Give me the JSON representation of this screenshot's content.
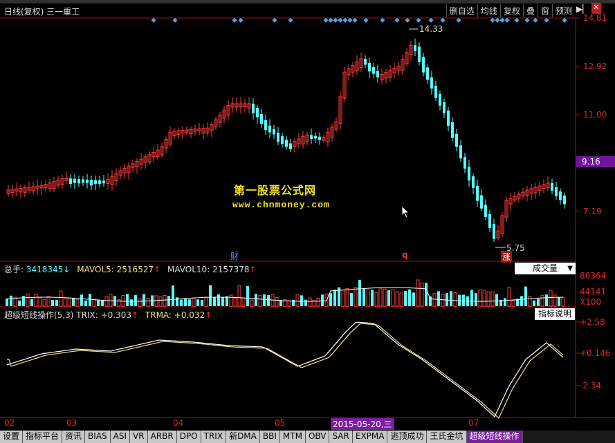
{
  "window": {
    "title": "日线(复权) 三一重工"
  },
  "toolbar": {
    "items": [
      "删自选",
      "均线",
      "复权",
      "叠",
      "窗",
      "预测"
    ],
    "arrow_icon": "arrow-right-icon",
    "close_icon": "close-icon"
  },
  "price_axis": [
    "14.81",
    "12.92",
    "11.00",
    "9.16",
    "7.19"
  ],
  "current_price": "9.16",
  "annotations": {
    "high": "14.33",
    "low": "5.75",
    "marker_cai": "财",
    "marker_q": "q",
    "marker_zhang": "涨"
  },
  "watermark": {
    "line1": "第一股票公式网",
    "line2": "www.chnmoney.com"
  },
  "volume": {
    "total_label": "总手:",
    "total_value": "3418345",
    "mavol5_label": "MAVOL5:",
    "mavol5_value": "2516527",
    "mavol10_label": "MAVOL10:",
    "mavol10_value": "2157378",
    "type_select": "成交量",
    "axis": [
      "86364",
      "44141",
      "X100"
    ]
  },
  "indicator": {
    "name": "超级短线操作(5,3)",
    "trix_label": "TRIX:",
    "trix_value": "+0.303",
    "trma_label": "TRMA:",
    "trma_value": "+0.032",
    "help_button": "指标说明",
    "axis": [
      "+2.58",
      "+0.146",
      "-2.34"
    ]
  },
  "date_axis": [
    "02",
    "03",
    "04",
    "05",
    "2015-05-20,三",
    "07"
  ],
  "tabs": [
    "设置",
    "指标平台",
    "资讯",
    "BIAS",
    "ASI",
    "VR",
    "ARBR",
    "DPO",
    "TRIX",
    "新DMA",
    "BBI",
    "MTM",
    "OBV",
    "SAR",
    "EXPMA",
    "逃顶成功",
    "王氏金坑",
    "超级短线操作"
  ],
  "active_tab": "超级短线操作",
  "colors": {
    "up": "#ff3c3c",
    "down": "#54ffff",
    "bg": "#000000",
    "axis": "#dc2828",
    "highlight": "#7a1ea0",
    "watermark": "#f0e022"
  }
}
